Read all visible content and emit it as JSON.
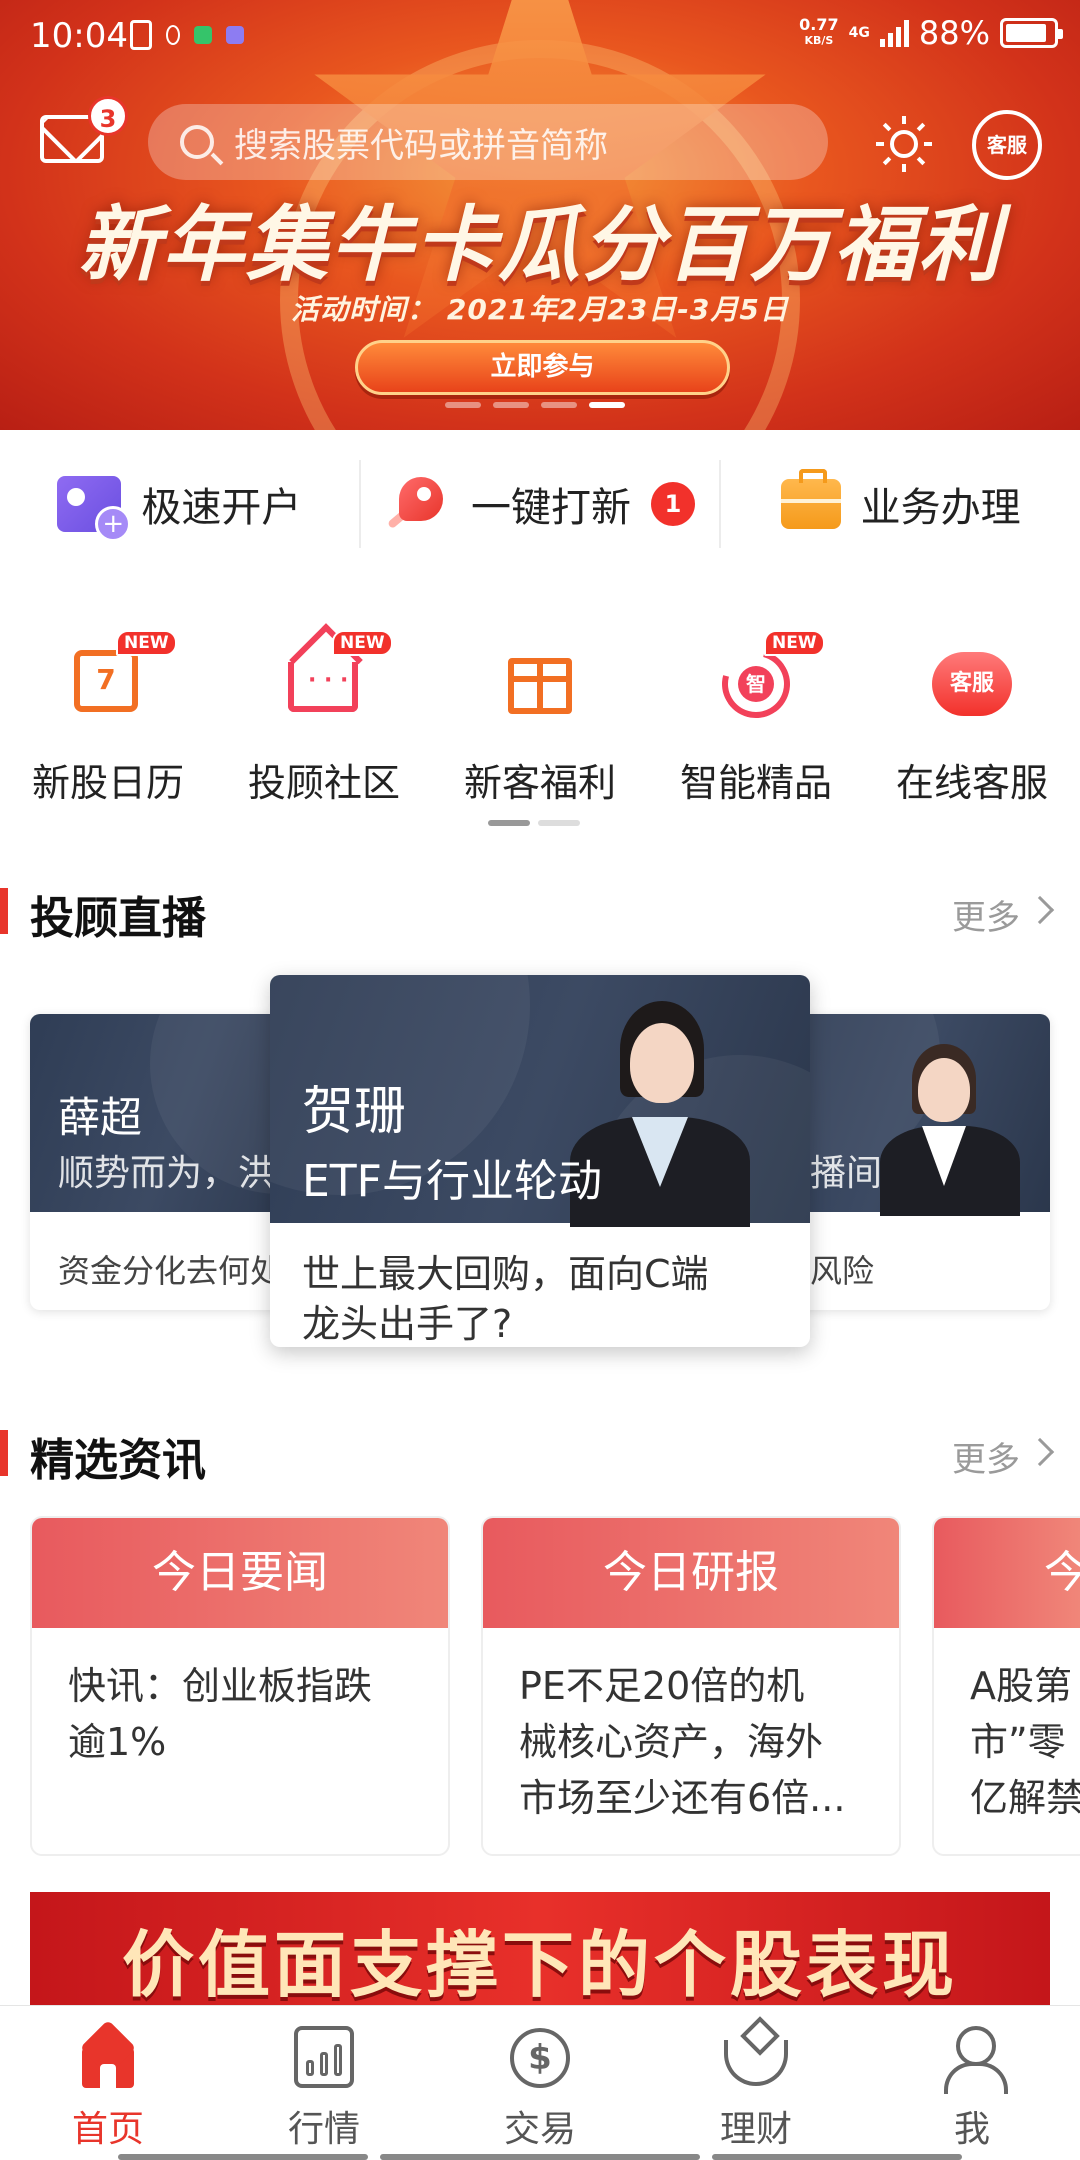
{
  "status_bar": {
    "time": "10:04",
    "net_speed_value": "0.77",
    "net_speed_unit": "KB/S",
    "network": "4G",
    "battery": "88%"
  },
  "header": {
    "mail_badge": "3",
    "search_placeholder": "搜索股票代码或拼音简称",
    "service_label": "客服"
  },
  "banner": {
    "title": "新年集牛卡瓜分百万福利",
    "date": "活动时间： 2021年2月23日-3月5日",
    "cta": "立即参与",
    "slides": 4,
    "active_slide": 3
  },
  "quick_actions": [
    {
      "label": "极速开户",
      "icon": "open-account-icon"
    },
    {
      "label": "一键打新",
      "icon": "rocket-icon",
      "badge": "1"
    },
    {
      "label": "业务办理",
      "icon": "briefcase-icon"
    }
  ],
  "grid": {
    "items": [
      {
        "label": "新股日历",
        "icon": "calendar-icon",
        "new": "NEW",
        "icon_text": "7"
      },
      {
        "label": "投顾社区",
        "icon": "community-icon",
        "new": "NEW"
      },
      {
        "label": "新客福利",
        "icon": "gift-icon"
      },
      {
        "label": "智能精品",
        "icon": "smart-icon",
        "new": "NEW",
        "icon_text": "智"
      },
      {
        "label": "在线客服",
        "icon": "customer-service-icon",
        "icon_text": "客服"
      }
    ]
  },
  "live": {
    "title": "投顾直播",
    "more": "更多",
    "cards": [
      {
        "name": "薛超",
        "subtitle": "顺势而为，洪",
        "desc": "资金分化去何处"
      },
      {
        "name": "贺珊",
        "subtitle": "ETF与行业轮动",
        "desc_line1": "世上最大回购，面向C端",
        "desc_line2": "龙头出手了?"
      },
      {
        "name": "",
        "subtitle": "播间",
        "desc": "风险"
      }
    ]
  },
  "news": {
    "title": "精选资讯",
    "more": "更多",
    "cards": [
      {
        "head": "今日要闻",
        "line1": "快讯：创业板指跌",
        "line2": "逾1%",
        "line3": ""
      },
      {
        "head": "今日研报",
        "line1": "PE不足20倍的机",
        "line2": "械核心资产，海外",
        "line3": "市场至少还有6倍..."
      },
      {
        "head": "今",
        "line1": "A股第",
        "line2": "市”零",
        "line3": "亿解禁"
      }
    ]
  },
  "promo": {
    "text": "价值面支撑下的个股表现"
  },
  "bottom_nav": [
    {
      "label": "首页",
      "active": true
    },
    {
      "label": "行情"
    },
    {
      "label": "交易"
    },
    {
      "label": "理财"
    },
    {
      "label": "我"
    }
  ],
  "colors": {
    "accent": "#e8352b",
    "live_card_bg": "#36435b",
    "news_head": "#ec6f6c"
  }
}
